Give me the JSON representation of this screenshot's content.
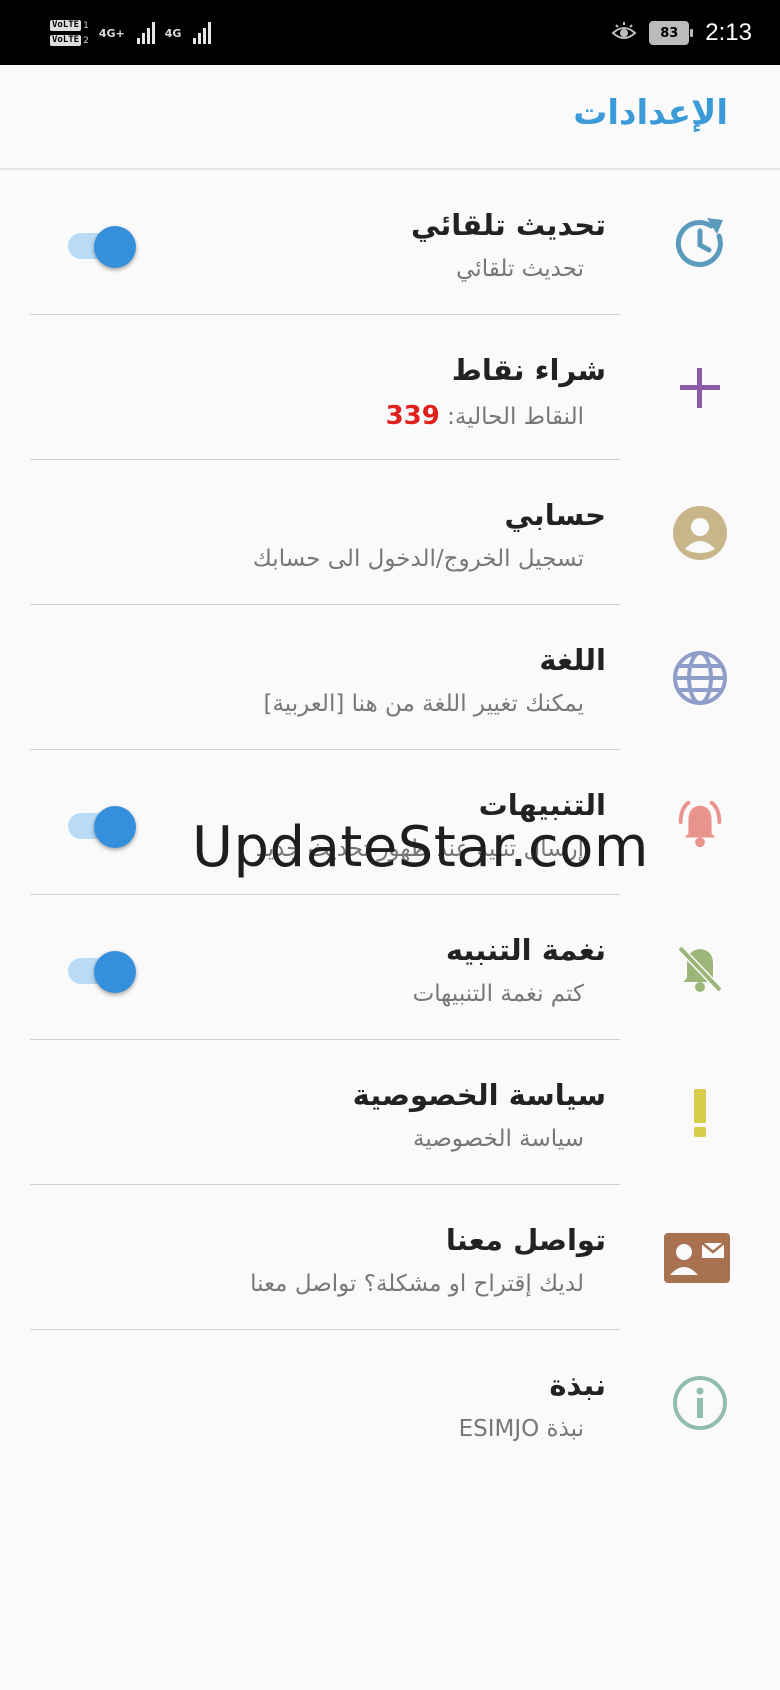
{
  "status_bar": {
    "volte_1": "VoLTE",
    "volte_1_num": "1",
    "volte_2": "VoLTE",
    "volte_2_num": "2",
    "network_1": "4G+",
    "network_2": "4G",
    "battery": "83",
    "time": "2:13"
  },
  "app_bar": {
    "title": "الإعدادات"
  },
  "settings": [
    {
      "title": "تحديث تلقائي",
      "subtitle": "تحديث تلقائي",
      "icon": "auto-update-icon",
      "icon_color": "#5a9bbd",
      "toggle": true
    },
    {
      "title": "شراء نقاط",
      "subtitle": "النقاط الحالية:",
      "points": "339",
      "icon": "plus-icon",
      "icon_color": "#8a5aa8",
      "toggle": false
    },
    {
      "title": "حسابي",
      "subtitle": "تسجيل الخروج/الدخول الى حسابك",
      "icon": "account-icon",
      "icon_color": "#c9b58a",
      "toggle": false
    },
    {
      "title": "اللغة",
      "subtitle": "يمكنك تغيير اللغة من هنا [العربية]",
      "icon": "globe-icon",
      "icon_color": "#8f9ec9",
      "toggle": false
    },
    {
      "title": "التنبيهات",
      "subtitle": "إرسال تنبيه عند ظهور تحديث جديد",
      "icon": "bell-ring-icon",
      "icon_color": "#e8948c",
      "toggle": true
    },
    {
      "title": "نغمة التنبيه",
      "subtitle": "كتم نغمة التنبيهات",
      "icon": "bell-off-icon",
      "icon_color": "#9cb67a",
      "toggle": true
    },
    {
      "title": "سياسة الخصوصية",
      "subtitle": "سياسة الخصوصية",
      "icon": "exclamation-icon",
      "icon_color": "#d9cc4a",
      "toggle": false
    },
    {
      "title": "تواصل معنا",
      "subtitle": "لديك إقتراح او مشكلة؟ تواصل معنا",
      "icon": "contact-card-icon",
      "icon_color": "#a8714f",
      "toggle": false
    },
    {
      "title": "نبذة",
      "subtitle": "نبذة ESIMJO",
      "icon": "info-icon",
      "icon_color": "#8fbfac",
      "toggle": false
    }
  ],
  "watermark": "UpdateStar.com"
}
